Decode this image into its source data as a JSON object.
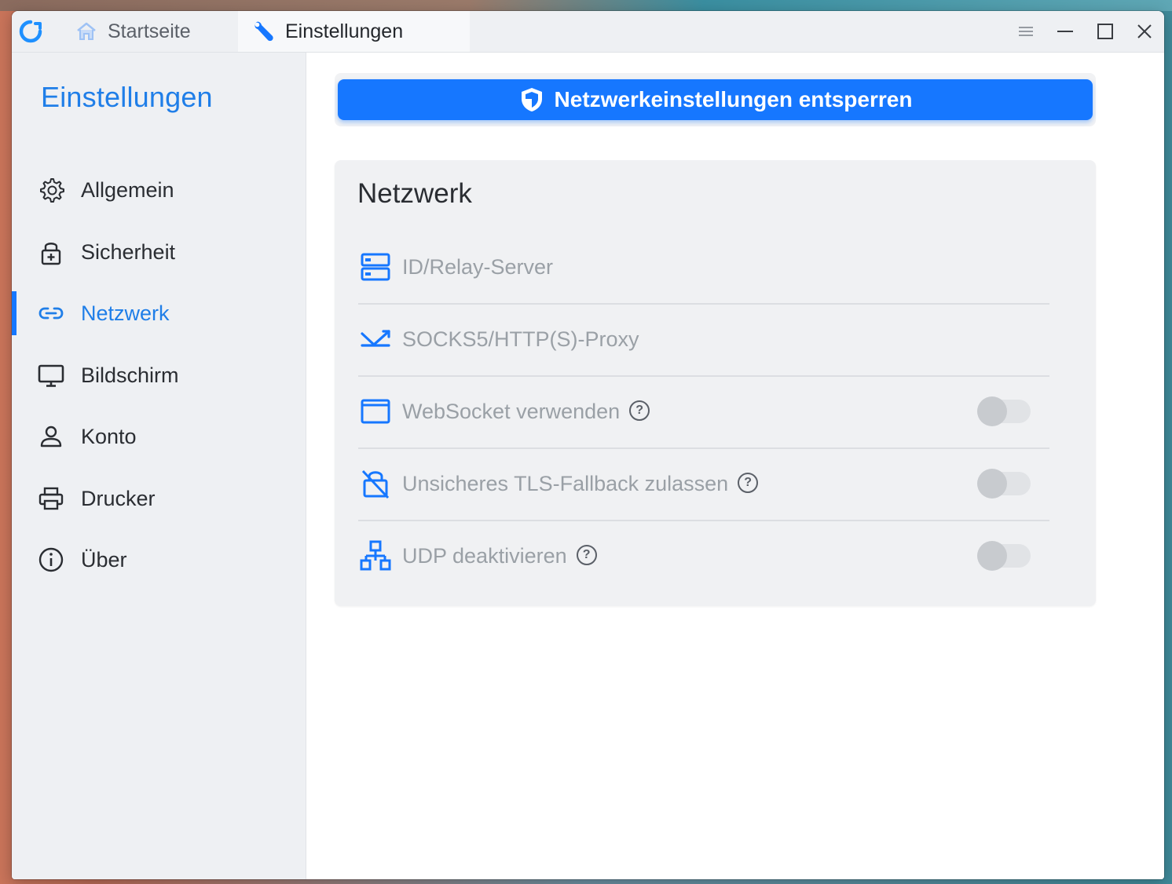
{
  "window": {
    "tabs": [
      {
        "label": "Startseite",
        "icon": "home-icon"
      },
      {
        "label": "Einstellungen",
        "icon": "wrench-icon"
      }
    ],
    "controls": [
      "menu-icon",
      "minimize-icon",
      "maximize-icon",
      "close-icon"
    ]
  },
  "sidebar": {
    "title": "Einstellungen",
    "items": [
      {
        "label": "Allgemein",
        "icon": "gear-icon"
      },
      {
        "label": "Sicherheit",
        "icon": "lock-icon"
      },
      {
        "label": "Netzwerk",
        "icon": "link-icon",
        "active": true
      },
      {
        "label": "Bildschirm",
        "icon": "monitor-icon"
      },
      {
        "label": "Konto",
        "icon": "user-icon"
      },
      {
        "label": "Drucker",
        "icon": "printer-icon"
      },
      {
        "label": "Über",
        "icon": "info-icon"
      }
    ]
  },
  "main": {
    "unlock_button": "Netzwerkeinstellungen entsperren",
    "card": {
      "title": "Netzwerk",
      "rows": [
        {
          "label": "ID/Relay-Server",
          "icon": "server-icon"
        },
        {
          "label": "SOCKS5/HTTP(S)-Proxy",
          "icon": "proxy-icon"
        },
        {
          "label": "WebSocket verwenden",
          "icon": "window-icon",
          "toggle": false
        },
        {
          "label": "Unsicheres TLS-Fallback zulassen",
          "icon": "lock-off-icon",
          "toggle": false
        },
        {
          "label": "UDP deaktivieren",
          "icon": "network-tree-icon",
          "toggle": false
        }
      ],
      "help_glyph": "?"
    }
  },
  "colors": {
    "accent": "#1677ff",
    "accent_text": "#1f7ee8",
    "sidebar_bg": "#eef0f3",
    "disabled_text": "#9aa0a6"
  }
}
